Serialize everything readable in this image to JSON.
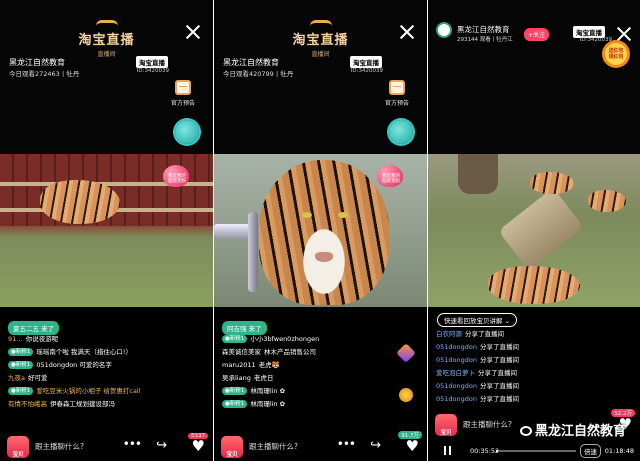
{
  "panel1": {
    "logo_main": "淘宝直播",
    "logo_sub": "直播间",
    "host_name": "黑龙江自然教育",
    "stats": "今日观看272463丨牡丹",
    "badge": "淘宝直播",
    "room_id": "ID:3420039",
    "preview_label": "官方预告",
    "heart_badge": "我是我的\n超级宠粉",
    "join_banner": "夏五二五 来了",
    "comments": [
      {
        "level": "",
        "user": "91…",
        "text": "你说夜游呢"
      },
      {
        "level": "●新粉1",
        "user": "",
        "text": "瑶瑶南个啦  我满天（措住心口!）"
      },
      {
        "level": "●新粉1",
        "user": "",
        "text": "051dongdon  可爱的名字"
      },
      {
        "level": "",
        "user": "九夜a",
        "text": "好可爱"
      },
      {
        "level": "●新粉1",
        "user": "",
        "text": "爱吃豆米火锅的小相子  给贺惠打call"
      },
      {
        "level": "",
        "user": "有情不怕峨高",
        "text": "伊春森工规划建设部冯"
      }
    ],
    "chat_placeholder": "跟主播聊什么?",
    "shop_label": "宝贝",
    "like_count": "5537"
  },
  "panel2": {
    "logo_main": "淘宝直播",
    "logo_sub": "直播间",
    "host_name": "黑龙江自然教育",
    "stats": "今日观看420799丨牡丹",
    "badge": "淘宝直播",
    "room_id": "ID:3420039",
    "preview_label": "官方预告",
    "heart_badge": "我是我的\n超级宠粉",
    "join_banner": "阿吉强 来了",
    "comments": [
      {
        "level": "●新粉1",
        "user": "",
        "text": "小小3bfwen0zhongen"
      },
      {
        "level": "",
        "user": "森美诚信美家",
        "text": "林木产品销售公司"
      },
      {
        "level": "",
        "user": "maru2011",
        "text": "老虎🐯"
      },
      {
        "level": "",
        "user": "吴承liang",
        "text": "老虎日"
      },
      {
        "level": "●新粉1",
        "user": "",
        "text": "林雨珊lin ✿"
      },
      {
        "level": "●新粉1",
        "user": "",
        "text": "林雨珊lin ✿"
      }
    ],
    "chat_placeholder": "跟主播聊什么?",
    "shop_label": "宝贝",
    "like_count": "91.7万"
  },
  "panel3": {
    "host_name": "黑龙江自然教育",
    "stats": "293144 观看丨牡丹江",
    "follow": "+关注",
    "badge": "淘宝直播",
    "room_id": "ID:3420039",
    "redpack": "送红包\n领红包",
    "quick_pill": "快速看回放宝贝讲解  ⌄",
    "comments": [
      {
        "user": "白衣阿源",
        "text": "分享了直播间"
      },
      {
        "user": "051dongdon",
        "text": "分享了直播间"
      },
      {
        "user": "051dongdon",
        "text": "分享了直播间"
      },
      {
        "user": "爱吃泡白萝卜",
        "text": "分享了直播间"
      },
      {
        "user": "051dongdon",
        "text": "分享了直播间"
      },
      {
        "user": "051dongdon",
        "text": "分享了直播间"
      }
    ],
    "chat_placeholder": "跟主播聊什么?",
    "shop_label": "宝贝",
    "like_count": "52.2万",
    "time_current": "00:35:52",
    "time_total": "01:18:48",
    "progress": 0.03,
    "speed": "倍速"
  },
  "watermark": "黑龙江自然教育"
}
